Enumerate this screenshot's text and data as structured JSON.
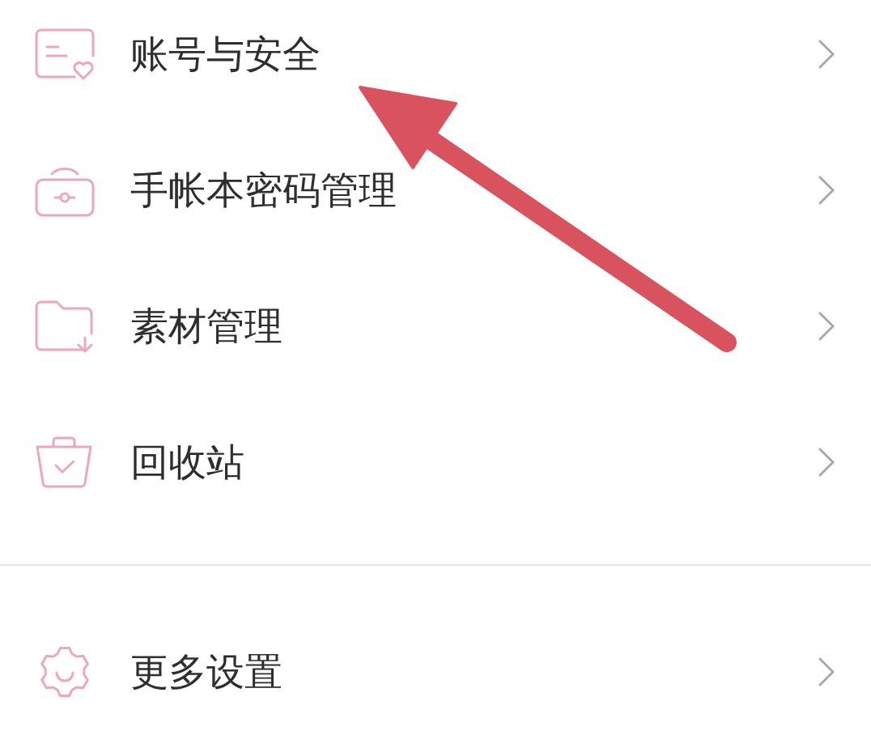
{
  "menu_groups": [
    {
      "items": [
        {
          "label": "账号与安全"
        },
        {
          "label": "手帐本密码管理"
        },
        {
          "label": "素材管理"
        },
        {
          "label": "回收站"
        }
      ]
    },
    {
      "items": [
        {
          "label": "更多设置"
        }
      ]
    }
  ]
}
